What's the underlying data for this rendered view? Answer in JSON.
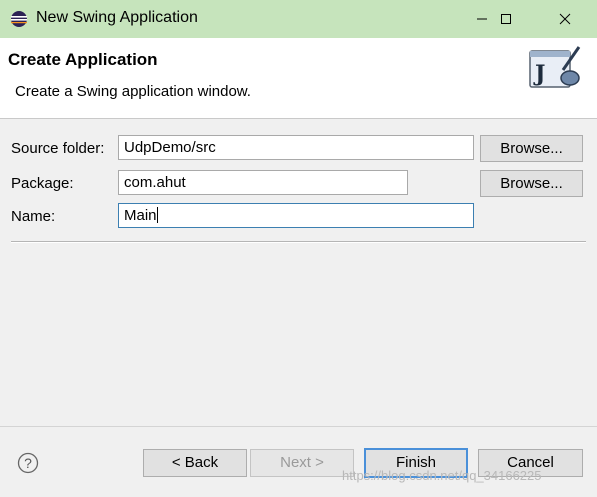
{
  "window": {
    "title": "New Swing Application",
    "icon": "eclipse-icon",
    "controls": [
      "minimize-icon",
      "maximize-icon",
      "close-icon"
    ]
  },
  "header": {
    "title": "Create Application",
    "description": "Create a Swing application window.",
    "banner_icon": "java-wizard-icon",
    "banner_letter": "J"
  },
  "form": {
    "source_folder": {
      "label": "Source folder:",
      "value": "UdpDemo/src",
      "button": "Browse..."
    },
    "package": {
      "label": "Package:",
      "value": "com.ahut",
      "button": "Browse..."
    },
    "name": {
      "label": "Name:",
      "value": "Main"
    }
  },
  "footer": {
    "help_icon": "help-icon",
    "help_glyph": "?",
    "back": "< Back",
    "next": "Next >",
    "finish": "Finish",
    "cancel": "Cancel"
  },
  "watermark": "https://blog.csdn.net/qq_34166225",
  "colors": {
    "titlebar": "#c6e4bc",
    "header_bg": "#ffffff",
    "dialog_bg": "#f0f0f0",
    "focus_border": "#3c7fb1",
    "default_button_border": "#4a90d9"
  }
}
